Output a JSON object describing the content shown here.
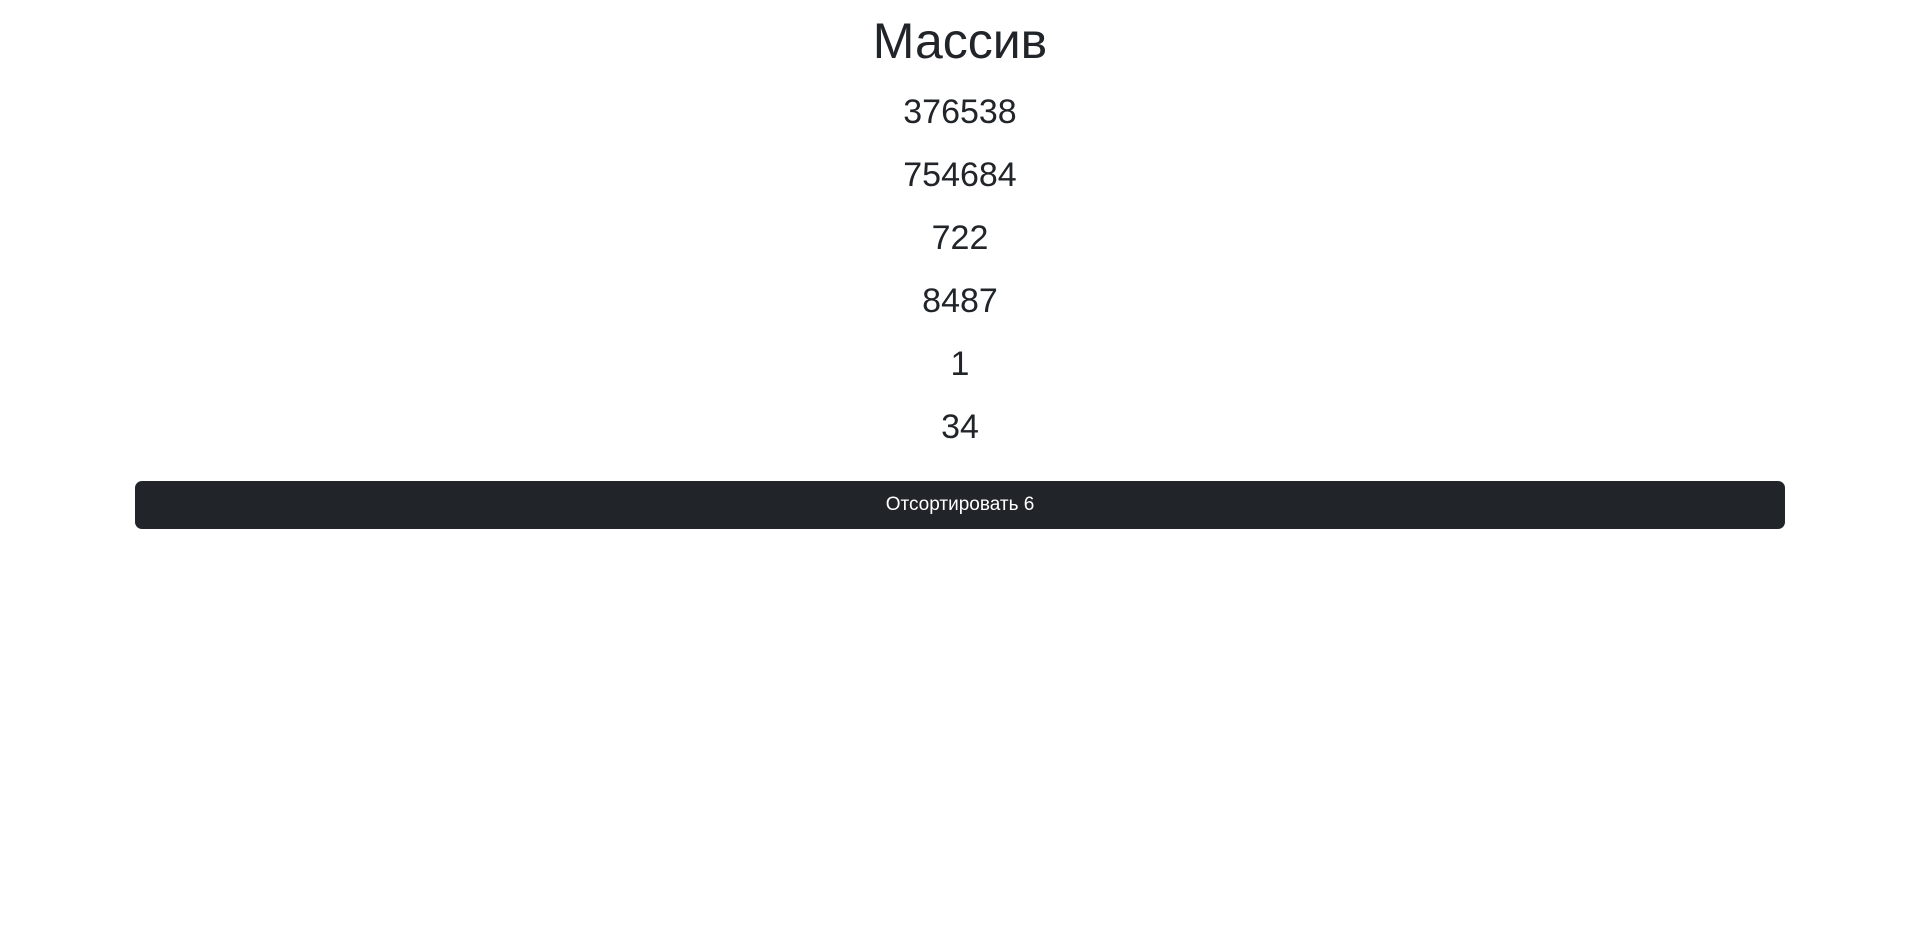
{
  "page": {
    "title": "Массив"
  },
  "array": {
    "items": [
      "376538",
      "754684",
      "722",
      "8487",
      "1",
      "34"
    ]
  },
  "actions": {
    "sort_label": "Отсортировать 6"
  },
  "colors": {
    "text": "#212529",
    "button_bg": "#212529",
    "button_text": "#ffffff",
    "background": "#ffffff"
  }
}
